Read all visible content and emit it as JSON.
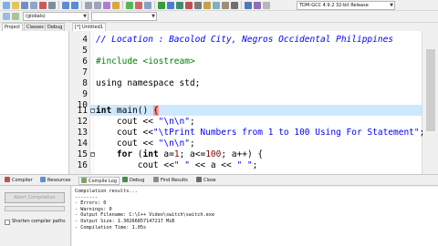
{
  "toolbar": {
    "compiler_profile": "TDM-GCC 4.9.2 32-bit Release",
    "scope_combo": "(globals)",
    "colors": {
      "accent": "#3c78d8",
      "active_line": "#cde8ff"
    }
  },
  "panel_tabs": [
    "Project",
    "Classes",
    "Debug"
  ],
  "editor_tab": "[*] Untitled1",
  "editor": {
    "line_numbers": [
      "4",
      "5",
      "6",
      "7",
      "8",
      "9",
      "10",
      "11",
      "12",
      "13",
      "14",
      "15",
      "16"
    ],
    "l4": "// Location : Bacolod City, Negros Occidental Philippines",
    "l6": "#include <iostream>",
    "l8": "using namespace std;",
    "l11_kw": "int",
    "l11_rest": " main() ",
    "l11_brace": "{",
    "l12_a": "    cout << ",
    "l12_s": "\"\\n\\n\"",
    "l12_b": ";",
    "l13_a": "    cout <<",
    "l13_s": "\"\\tPrint Numbers from 1 to 100 Using For Statement\"",
    "l13_b": ";",
    "l14_a": "    cout << ",
    "l14_s": "\"\\n\\n\"",
    "l14_b": ";",
    "l15_kw": "    for",
    "l15_a": " (",
    "l15_kw2": "int",
    "l15_b": " a=",
    "l15_n1": "1",
    "l15_c": "; a<=",
    "l15_n2": "100",
    "l15_d": "; a++) {",
    "l16_a": "        cout <<",
    "l16_s": "\" \"",
    "l16_b": " << a << ",
    "l16_s2": "\" \"",
    "l16_c": ";"
  },
  "bottom_tabs": [
    "Compiler",
    "Resources",
    "Compile Log",
    "Debug",
    "Find Results",
    "Close"
  ],
  "bottom_left": {
    "abort_label": "Abort Compilation",
    "progress": 0,
    "shorten_label": "Shorten compiler paths"
  },
  "log_lines": [
    "Compilation results...",
    "--------",
    "- Errors: 0",
    "- Warnings: 0",
    "- Output Filename: C:\\C++ Video\\switch\\switch.exe",
    "- Output Size: 1.30266857147217 MiB",
    "- Compilation Time: 1.05s"
  ]
}
